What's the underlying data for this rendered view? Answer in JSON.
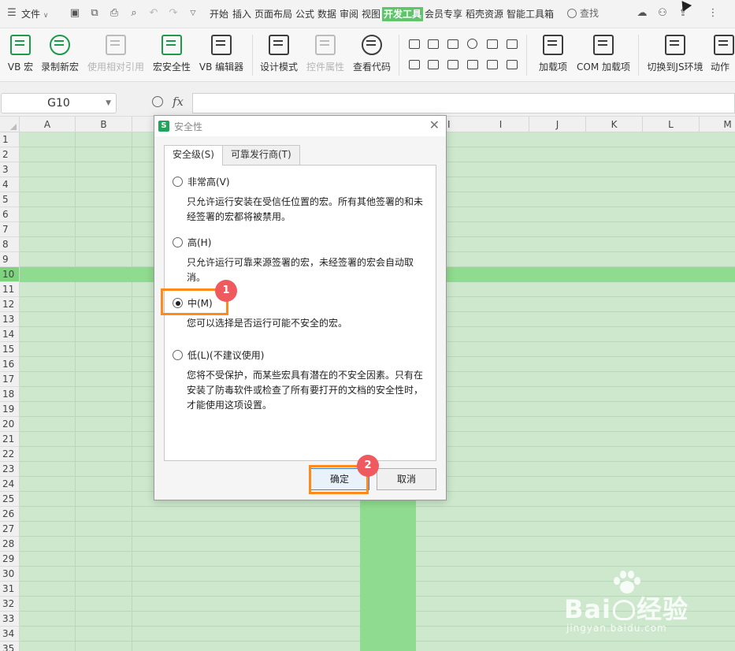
{
  "menubar": {
    "file_label": "文件",
    "tabs": [
      "开始",
      "插入",
      "页面布局",
      "公式",
      "数据",
      "审阅",
      "视图",
      "开发工具",
      "会员专享",
      "稻壳资源",
      "智能工具箱"
    ],
    "active_tab": "开发工具",
    "search_label": "查找",
    "active_color": "#5fc56b"
  },
  "ribbon": {
    "buttons": [
      "VB 宏",
      "录制新宏",
      "使用相对引用",
      "宏安全性",
      "VB 编辑器",
      "设计模式",
      "控件属性",
      "查看代码",
      "加载项",
      "COM 加载项",
      "切换到JS环境",
      "动作"
    ]
  },
  "formula_bar": {
    "cell_ref": "G10",
    "fx_label": "fx",
    "formula": ""
  },
  "grid": {
    "columns": [
      "A",
      "B",
      "",
      "",
      "",
      "",
      "",
      "",
      "I",
      "I",
      "J",
      "K",
      "L",
      "M"
    ],
    "rows": [
      "1",
      "2",
      "3",
      "4",
      "5",
      "6",
      "7",
      "8",
      "9",
      "10",
      "11",
      "12",
      "13",
      "14",
      "15",
      "16",
      "17",
      "18",
      "19",
      "20",
      "21",
      "22",
      "23",
      "24",
      "25",
      "26",
      "27",
      "28",
      "29",
      "30",
      "31",
      "32",
      "33",
      "34",
      "35"
    ],
    "selected_row": "10",
    "grid_color": "#cde8cd",
    "highlight_color": "#8fdb8f"
  },
  "dialog": {
    "title": "安全性",
    "tabs": [
      "安全级(S)",
      "可靠发行商(T)"
    ],
    "options": [
      {
        "label": "非常高(V)",
        "desc_lines": [
          "只允许运行安装在受信任位置的宏。所有其他签署的和未",
          "经签署的宏都将被禁用。"
        ],
        "selected": false
      },
      {
        "label": "高(H)",
        "desc_lines": [
          "只允许运行可靠来源签署的宏，未经签署的宏会自动取",
          "消。"
        ],
        "selected": false
      },
      {
        "label": "中(M)",
        "desc_lines": [
          "您可以选择是否运行可能不安全的宏。"
        ],
        "selected": true
      },
      {
        "label": "低(L)(不建议使用)",
        "desc_lines": [
          "您将不受保护，而某些宏具有潜在的不安全因素。只有在",
          "安装了防毒软件或检查了所有要打开的文档的安全性时，",
          "才能使用这项设置。"
        ],
        "selected": false
      }
    ],
    "ok_label": "确定",
    "cancel_label": "取消"
  },
  "annotations": {
    "marker1": "1",
    "marker2": "2",
    "box_color": "#ff8a1c",
    "marker_color": "#ef5a5f"
  },
  "watermark": {
    "brand": "Bai",
    "brand_suffix": "经验",
    "url": "jingyan.baidu.com"
  }
}
